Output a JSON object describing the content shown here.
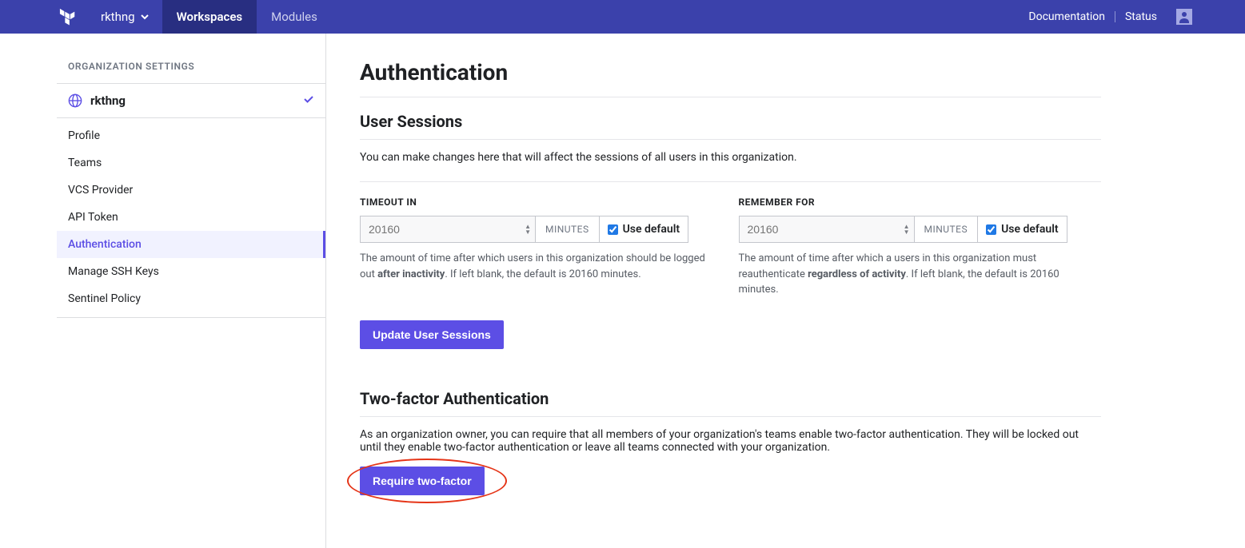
{
  "topbar": {
    "org_name": "rkthng",
    "nav": {
      "workspaces": "Workspaces",
      "modules": "Modules"
    },
    "right": {
      "documentation": "Documentation",
      "status": "Status"
    }
  },
  "sidebar": {
    "title": "ORGANIZATION SETTINGS",
    "org_name": "rkthng",
    "items": {
      "profile": "Profile",
      "teams": "Teams",
      "vcs": "VCS Provider",
      "api_token": "API Token",
      "authentication": "Authentication",
      "ssh": "Manage SSH Keys",
      "sentinel": "Sentinel Policy"
    }
  },
  "main": {
    "title": "Authentication",
    "sessions": {
      "heading": "User Sessions",
      "desc": "You can make changes here that will affect the sessions of all users in this organization.",
      "timeout": {
        "label": "TIMEOUT IN",
        "placeholder": "20160",
        "unit": "MINUTES",
        "use_default": "Use default",
        "help_a": "The amount of time after which users in this organization should be logged out ",
        "help_strong": "after inactivity",
        "help_b": ". If left blank, the default is 20160 minutes."
      },
      "remember": {
        "label": "REMEMBER FOR",
        "placeholder": "20160",
        "unit": "MINUTES",
        "use_default": "Use default",
        "help_a": "The amount of time after which a users in this organization must reauthenticate ",
        "help_strong": "regardless of activity",
        "help_b": ". If left blank, the default is 20160 minutes."
      },
      "update_btn": "Update User Sessions"
    },
    "twofa": {
      "heading": "Two-factor Authentication",
      "desc": "As an organization owner, you can require that all members of your organization's teams enable two-factor authentication. They will be locked out until they enable two-factor authentication or leave all teams connected with your organization.",
      "require_btn": "Require two-factor"
    }
  }
}
